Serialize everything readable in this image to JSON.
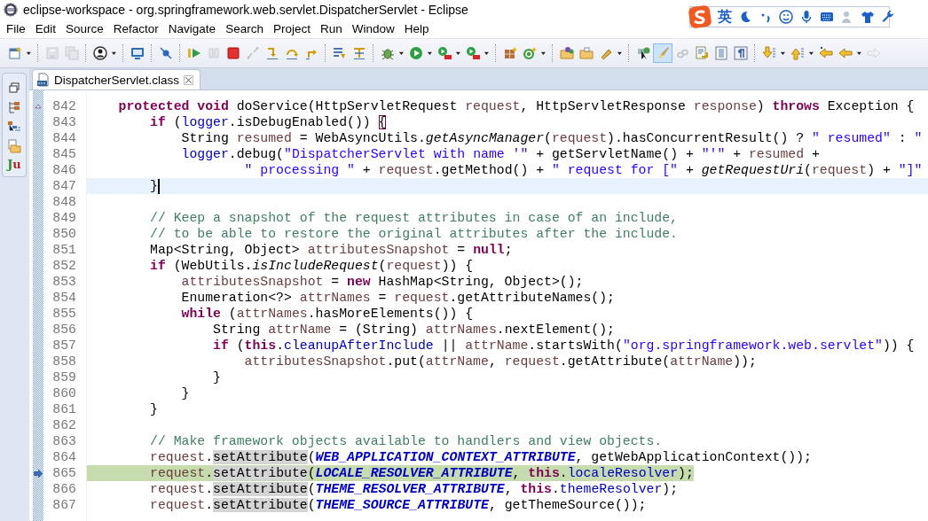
{
  "window": {
    "title": "eclipse-workspace - org.springframework.web.servlet.DispatcherServlet - Eclipse"
  },
  "ime_bar": {
    "language": "英"
  },
  "menu": [
    "File",
    "Edit",
    "Source",
    "Refactor",
    "Navigate",
    "Search",
    "Project",
    "Run",
    "Window",
    "Help"
  ],
  "toolbar": [
    {
      "kind": "button",
      "disabled": false,
      "selected": false
    },
    {
      "kind": "dropdown"
    },
    {
      "kind": "separator"
    },
    {
      "kind": "button",
      "disabled": true,
      "selected": false
    },
    {
      "kind": "button",
      "disabled": true,
      "selected": false
    },
    {
      "kind": "separator"
    },
    {
      "kind": "button",
      "disabled": false,
      "selected": false
    },
    {
      "kind": "dropdown"
    },
    {
      "kind": "separator"
    },
    {
      "kind": "button",
      "disabled": false,
      "selected": false
    },
    {
      "kind": "separator"
    },
    {
      "kind": "button",
      "disabled": false,
      "selected": false
    },
    {
      "kind": "separator"
    },
    {
      "kind": "button",
      "disabled": false,
      "selected": false
    },
    {
      "kind": "button",
      "disabled": true,
      "selected": false
    },
    {
      "kind": "button",
      "disabled": false,
      "selected": false
    },
    {
      "kind": "button",
      "disabled": true,
      "selected": false
    },
    {
      "kind": "button",
      "disabled": false,
      "selected": false
    },
    {
      "kind": "button",
      "disabled": false,
      "selected": false
    },
    {
      "kind": "button",
      "disabled": false,
      "selected": false
    },
    {
      "kind": "separator"
    },
    {
      "kind": "button",
      "disabled": false,
      "selected": false
    },
    {
      "kind": "button",
      "disabled": false,
      "selected": false
    },
    {
      "kind": "separator"
    },
    {
      "kind": "button",
      "disabled": false,
      "selected": false
    },
    {
      "kind": "dropdown"
    },
    {
      "kind": "button",
      "disabled": false,
      "selected": false
    },
    {
      "kind": "dropdown"
    },
    {
      "kind": "button",
      "disabled": false,
      "selected": false
    },
    {
      "kind": "dropdown"
    },
    {
      "kind": "button",
      "disabled": false,
      "selected": false
    },
    {
      "kind": "dropdown"
    },
    {
      "kind": "separator"
    },
    {
      "kind": "button",
      "disabled": false,
      "selected": false
    },
    {
      "kind": "button",
      "disabled": false,
      "selected": false
    },
    {
      "kind": "dropdown"
    },
    {
      "kind": "separator"
    },
    {
      "kind": "button",
      "disabled": false,
      "selected": false
    },
    {
      "kind": "button",
      "disabled": false,
      "selected": false
    },
    {
      "kind": "button",
      "disabled": false,
      "selected": false
    },
    {
      "kind": "dropdown"
    },
    {
      "kind": "separator"
    },
    {
      "kind": "button",
      "disabled": false,
      "selected": false
    },
    {
      "kind": "button",
      "disabled": false,
      "selected": true
    },
    {
      "kind": "button",
      "disabled": true,
      "selected": false
    },
    {
      "kind": "button",
      "disabled": false,
      "selected": false
    },
    {
      "kind": "button",
      "disabled": false,
      "selected": false
    },
    {
      "kind": "button",
      "disabled": false,
      "selected": false
    },
    {
      "kind": "separator"
    },
    {
      "kind": "button",
      "disabled": false,
      "selected": false
    },
    {
      "kind": "dropdown"
    },
    {
      "kind": "button",
      "disabled": false,
      "selected": false
    },
    {
      "kind": "dropdown"
    },
    {
      "kind": "button",
      "disabled": false,
      "selected": false
    },
    {
      "kind": "button",
      "disabled": false,
      "selected": false
    },
    {
      "kind": "dropdown"
    },
    {
      "kind": "button",
      "disabled": true,
      "selected": false
    }
  ],
  "side_trim": {
    "junit_label": "Ju"
  },
  "editor_tabs": [
    {
      "label": "DispatcherServlet.class",
      "selected": true
    }
  ],
  "lines": [
    {
      "number": "842",
      "kind": "normal",
      "override_marker": true,
      "instruction_pointer": false,
      "tokens": [
        {
          "text": "    protected",
          "kind": "keyword"
        },
        {
          "text": " void",
          "kind": "keyword"
        },
        {
          "text": " doService(HttpServletRequest ",
          "kind": "plain"
        },
        {
          "text": "request",
          "kind": "local"
        },
        {
          "text": ", HttpServletResponse ",
          "kind": "plain"
        },
        {
          "text": "response",
          "kind": "local"
        },
        {
          "text": ") ",
          "kind": "plain"
        },
        {
          "text": "throws",
          "kind": "keyword"
        },
        {
          "text": " Exception {",
          "kind": "plain"
        }
      ]
    },
    {
      "number": "843",
      "kind": "normal",
      "override_marker": false,
      "instruction_pointer": false,
      "tokens": [
        {
          "text": "        if",
          "kind": "keyword"
        },
        {
          "text": " (",
          "kind": "plain"
        },
        {
          "text": "logger",
          "kind": "field"
        },
        {
          "text": ".isDebugEnabled()) ",
          "kind": "plain"
        },
        {
          "text": "{",
          "kind": "bracket"
        }
      ]
    },
    {
      "number": "844",
      "kind": "normal",
      "override_marker": false,
      "instruction_pointer": false,
      "tokens": [
        {
          "text": "            String ",
          "kind": "plain"
        },
        {
          "text": "resumed",
          "kind": "local"
        },
        {
          "text": " = WebAsyncUtils.",
          "kind": "plain"
        },
        {
          "text": "getAsyncManager",
          "kind": "static"
        },
        {
          "text": "(",
          "kind": "plain"
        },
        {
          "text": "request",
          "kind": "local"
        },
        {
          "text": ").hasConcurrentResult() ? ",
          "kind": "plain"
        },
        {
          "text": "\" resumed\"",
          "kind": "string"
        },
        {
          "text": " : ",
          "kind": "plain"
        },
        {
          "text": "\"",
          "kind": "string"
        }
      ]
    },
    {
      "number": "845",
      "kind": "normal",
      "override_marker": false,
      "instruction_pointer": false,
      "tokens": [
        {
          "text": "            logger",
          "kind": "field"
        },
        {
          "text": ".debug(",
          "kind": "plain"
        },
        {
          "text": "\"DispatcherServlet with name '\"",
          "kind": "string"
        },
        {
          "text": " + getServletName() + ",
          "kind": "plain"
        },
        {
          "text": "\"'\"",
          "kind": "string"
        },
        {
          "text": " + ",
          "kind": "plain"
        },
        {
          "text": "resumed",
          "kind": "local"
        },
        {
          "text": " +",
          "kind": "plain"
        }
      ]
    },
    {
      "number": "846",
      "kind": "normal",
      "override_marker": false,
      "instruction_pointer": false,
      "tokens": [
        {
          "text": "                    \" processing \"",
          "kind": "string"
        },
        {
          "text": " + ",
          "kind": "plain"
        },
        {
          "text": "request",
          "kind": "local"
        },
        {
          "text": ".getMethod() + ",
          "kind": "plain"
        },
        {
          "text": "\" request for [\"",
          "kind": "string"
        },
        {
          "text": " + ",
          "kind": "plain"
        },
        {
          "text": "getRequestUri",
          "kind": "static"
        },
        {
          "text": "(",
          "kind": "plain"
        },
        {
          "text": "request",
          "kind": "local"
        },
        {
          "text": ") + ",
          "kind": "plain"
        },
        {
          "text": "\"]\"",
          "kind": "string"
        }
      ]
    },
    {
      "number": "847",
      "kind": "current",
      "override_marker": false,
      "instruction_pointer": false,
      "tokens": [
        {
          "text": "        }",
          "kind": "plain"
        }
      ]
    },
    {
      "number": "848",
      "kind": "normal",
      "override_marker": false,
      "instruction_pointer": false
    },
    {
      "number": "849",
      "kind": "normal",
      "override_marker": false,
      "instruction_pointer": false,
      "tokens": [
        {
          "text": "        // Keep a snapshot of the request attributes in case of an include,",
          "kind": "comment"
        }
      ]
    },
    {
      "number": "850",
      "kind": "normal",
      "override_marker": false,
      "instruction_pointer": false,
      "tokens": [
        {
          "text": "        // to be able to restore the original attributes after the include.",
          "kind": "comment"
        }
      ]
    },
    {
      "number": "851",
      "kind": "normal",
      "override_marker": false,
      "instruction_pointer": false,
      "tokens": [
        {
          "text": "        Map<String, Object> ",
          "kind": "plain"
        },
        {
          "text": "attributesSnapshot",
          "kind": "local"
        },
        {
          "text": " = ",
          "kind": "plain"
        },
        {
          "text": "null",
          "kind": "keyword"
        },
        {
          "text": ";",
          "kind": "plain"
        }
      ]
    },
    {
      "number": "852",
      "kind": "normal",
      "override_marker": false,
      "instruction_pointer": false,
      "tokens": [
        {
          "text": "        if",
          "kind": "keyword"
        },
        {
          "text": " (WebUtils.",
          "kind": "plain"
        },
        {
          "text": "isIncludeRequest",
          "kind": "static"
        },
        {
          "text": "(",
          "kind": "plain"
        },
        {
          "text": "request",
          "kind": "local"
        },
        {
          "text": ")) {",
          "kind": "plain"
        }
      ]
    },
    {
      "number": "853",
      "kind": "normal",
      "override_marker": false,
      "instruction_pointer": false,
      "tokens": [
        {
          "text": "            attributesSnapshot",
          "kind": "local"
        },
        {
          "text": " = ",
          "kind": "plain"
        },
        {
          "text": "new",
          "kind": "keyword"
        },
        {
          "text": " HashMap<String, Object>();",
          "kind": "plain"
        }
      ]
    },
    {
      "number": "854",
      "kind": "normal",
      "override_marker": false,
      "instruction_pointer": false,
      "tokens": [
        {
          "text": "            Enumeration<?> ",
          "kind": "plain"
        },
        {
          "text": "attrNames",
          "kind": "local"
        },
        {
          "text": " = ",
          "kind": "plain"
        },
        {
          "text": "request",
          "kind": "local"
        },
        {
          "text": ".getAttributeNames();",
          "kind": "plain"
        }
      ]
    },
    {
      "number": "855",
      "kind": "normal",
      "override_marker": false,
      "instruction_pointer": false,
      "tokens": [
        {
          "text": "            while",
          "kind": "keyword"
        },
        {
          "text": " (",
          "kind": "plain"
        },
        {
          "text": "attrNames",
          "kind": "local"
        },
        {
          "text": ".hasMoreElements()) {",
          "kind": "plain"
        }
      ]
    },
    {
      "number": "856",
      "kind": "normal",
      "override_marker": false,
      "instruction_pointer": false,
      "tokens": [
        {
          "text": "                String ",
          "kind": "plain"
        },
        {
          "text": "attrName",
          "kind": "local"
        },
        {
          "text": " = (String) ",
          "kind": "plain"
        },
        {
          "text": "attrNames",
          "kind": "local"
        },
        {
          "text": ".nextElement();",
          "kind": "plain"
        }
      ]
    },
    {
      "number": "857",
      "kind": "normal",
      "override_marker": false,
      "instruction_pointer": false,
      "tokens": [
        {
          "text": "                if",
          "kind": "keyword"
        },
        {
          "text": " (",
          "kind": "plain"
        },
        {
          "text": "this",
          "kind": "keyword"
        },
        {
          "text": ".",
          "kind": "plain"
        },
        {
          "text": "cleanupAfterInclude",
          "kind": "field"
        },
        {
          "text": " || ",
          "kind": "plain"
        },
        {
          "text": "attrName",
          "kind": "local"
        },
        {
          "text": ".startsWith(",
          "kind": "plain"
        },
        {
          "text": "\"org.springframework.web.servlet\"",
          "kind": "string"
        },
        {
          "text": ")) {",
          "kind": "plain"
        }
      ]
    },
    {
      "number": "858",
      "kind": "normal",
      "override_marker": false,
      "instruction_pointer": false,
      "tokens": [
        {
          "text": "                    attributesSnapshot",
          "kind": "local"
        },
        {
          "text": ".put(",
          "kind": "plain"
        },
        {
          "text": "attrName",
          "kind": "local"
        },
        {
          "text": ", ",
          "kind": "plain"
        },
        {
          "text": "request",
          "kind": "local"
        },
        {
          "text": ".getAttribute(",
          "kind": "plain"
        },
        {
          "text": "attrName",
          "kind": "local"
        },
        {
          "text": "));",
          "kind": "plain"
        }
      ]
    },
    {
      "number": "859",
      "kind": "normal",
      "override_marker": false,
      "instruction_pointer": false,
      "tokens": [
        {
          "text": "                }",
          "kind": "plain"
        }
      ]
    },
    {
      "number": "860",
      "kind": "normal",
      "override_marker": false,
      "instruction_pointer": false,
      "tokens": [
        {
          "text": "            }",
          "kind": "plain"
        }
      ]
    },
    {
      "number": "861",
      "kind": "normal",
      "override_marker": false,
      "instruction_pointer": false,
      "tokens": [
        {
          "text": "        }",
          "kind": "plain"
        }
      ]
    },
    {
      "number": "862",
      "kind": "normal",
      "override_marker": false,
      "instruction_pointer": false
    },
    {
      "number": "863",
      "kind": "normal",
      "override_marker": false,
      "instruction_pointer": false,
      "tokens": [
        {
          "text": "        // Make framework objects available to handlers and view objects.",
          "kind": "comment"
        }
      ]
    },
    {
      "number": "864",
      "kind": "normal",
      "override_marker": false,
      "instruction_pointer": false,
      "tokens": [
        {
          "text": "        request",
          "kind": "local"
        },
        {
          "text": ".",
          "kind": "plain"
        },
        {
          "text": "setAttribute",
          "kind": "occurrence"
        },
        {
          "text": "(",
          "kind": "plain"
        },
        {
          "text": "WEB_APPLICATION_CONTEXT_ATTRIBUTE",
          "kind": "constant"
        },
        {
          "text": ", getWebApplicationContext());",
          "kind": "plain"
        }
      ]
    },
    {
      "number": "865",
      "kind": "debug",
      "override_marker": false,
      "instruction_pointer": true,
      "tokens": [
        {
          "text": "        request",
          "kind": "local"
        },
        {
          "text": ".",
          "kind": "plain"
        },
        {
          "text": "setAttribute",
          "kind": "occurrence"
        },
        {
          "text": "(",
          "kind": "plain"
        },
        {
          "text": "LOCALE_RESOLVER_ATTRIBUTE",
          "kind": "constant"
        },
        {
          "text": ", ",
          "kind": "plain"
        },
        {
          "text": "this",
          "kind": "keyword"
        },
        {
          "text": ".",
          "kind": "plain"
        },
        {
          "text": "localeResolver",
          "kind": "field"
        },
        {
          "text": ");",
          "kind": "plain"
        }
      ]
    },
    {
      "number": "866",
      "kind": "normal",
      "override_marker": false,
      "instruction_pointer": false,
      "tokens": [
        {
          "text": "        request",
          "kind": "local"
        },
        {
          "text": ".",
          "kind": "plain"
        },
        {
          "text": "setAttribute",
          "kind": "occurrence"
        },
        {
          "text": "(",
          "kind": "plain"
        },
        {
          "text": "THEME_RESOLVER_ATTRIBUTE",
          "kind": "constant"
        },
        {
          "text": ", ",
          "kind": "plain"
        },
        {
          "text": "this",
          "kind": "keyword"
        },
        {
          "text": ".",
          "kind": "plain"
        },
        {
          "text": "themeResolver",
          "kind": "field"
        },
        {
          "text": ");",
          "kind": "plain"
        }
      ]
    },
    {
      "number": "867",
      "kind": "normal",
      "override_marker": false,
      "instruction_pointer": false,
      "tokens": [
        {
          "text": "        request",
          "kind": "local"
        },
        {
          "text": ".",
          "kind": "plain"
        },
        {
          "text": "setAttribute",
          "kind": "occurrence"
        },
        {
          "text": "(",
          "kind": "plain"
        },
        {
          "text": "THEME_SOURCE_ATTRIBUTE",
          "kind": "constant"
        },
        {
          "text": ", getThemeSource());",
          "kind": "plain"
        }
      ]
    }
  ]
}
